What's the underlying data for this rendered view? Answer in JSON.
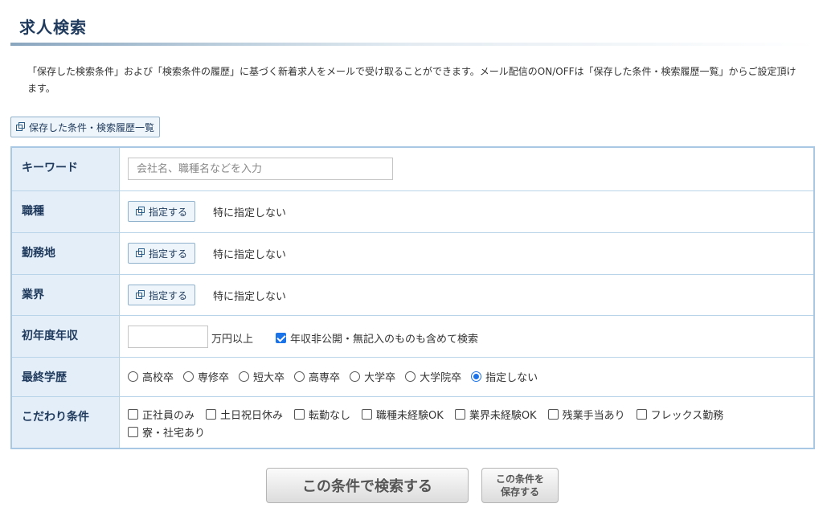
{
  "page": {
    "title": "求人検索",
    "intro": "「保存した検索条件」および「検索条件の履歴」に基づく新着求人をメールで受け取ることができます。メール配信のON/OFFは「保存した条件・検索履歴一覧」からご設定頂けます。"
  },
  "saved_link": {
    "label": "保存した条件・検索履歴一覧",
    "icon": "window-icon"
  },
  "form": {
    "keyword": {
      "label": "キーワード",
      "placeholder": "会社名、職種名などを入力",
      "value": ""
    },
    "job_type": {
      "label": "職種",
      "button": "指定する",
      "status": "特に指定しない"
    },
    "location": {
      "label": "勤務地",
      "button": "指定する",
      "status": "特に指定しない"
    },
    "industry": {
      "label": "業界",
      "button": "指定する",
      "status": "特に指定しない"
    },
    "salary": {
      "label": "初年度年収",
      "value": "",
      "unit": "万円以上",
      "include_undisclosed": {
        "label": "年収非公開・無記入のものも含めて検索",
        "checked": true
      }
    },
    "education": {
      "label": "最終学歴",
      "options": [
        "高校卒",
        "専修卒",
        "短大卒",
        "高専卒",
        "大学卒",
        "大学院卒",
        "指定しない"
      ],
      "selected": "指定しない"
    },
    "preferences": {
      "label": "こだわり条件",
      "options": [
        "正社員のみ",
        "土日祝日休み",
        "転勤なし",
        "職種未経験OK",
        "業界未経験OK",
        "残業手当あり",
        "フレックス勤務",
        "寮・社宅あり"
      ]
    }
  },
  "actions": {
    "search": "この条件で検索する",
    "save_line1": "この条件を",
    "save_line2": "保存する"
  },
  "colors": {
    "label_bg": "#e3eef9",
    "border": "#a8c8e4",
    "heading": "#1f3a5c",
    "check": "#1a73e8"
  }
}
